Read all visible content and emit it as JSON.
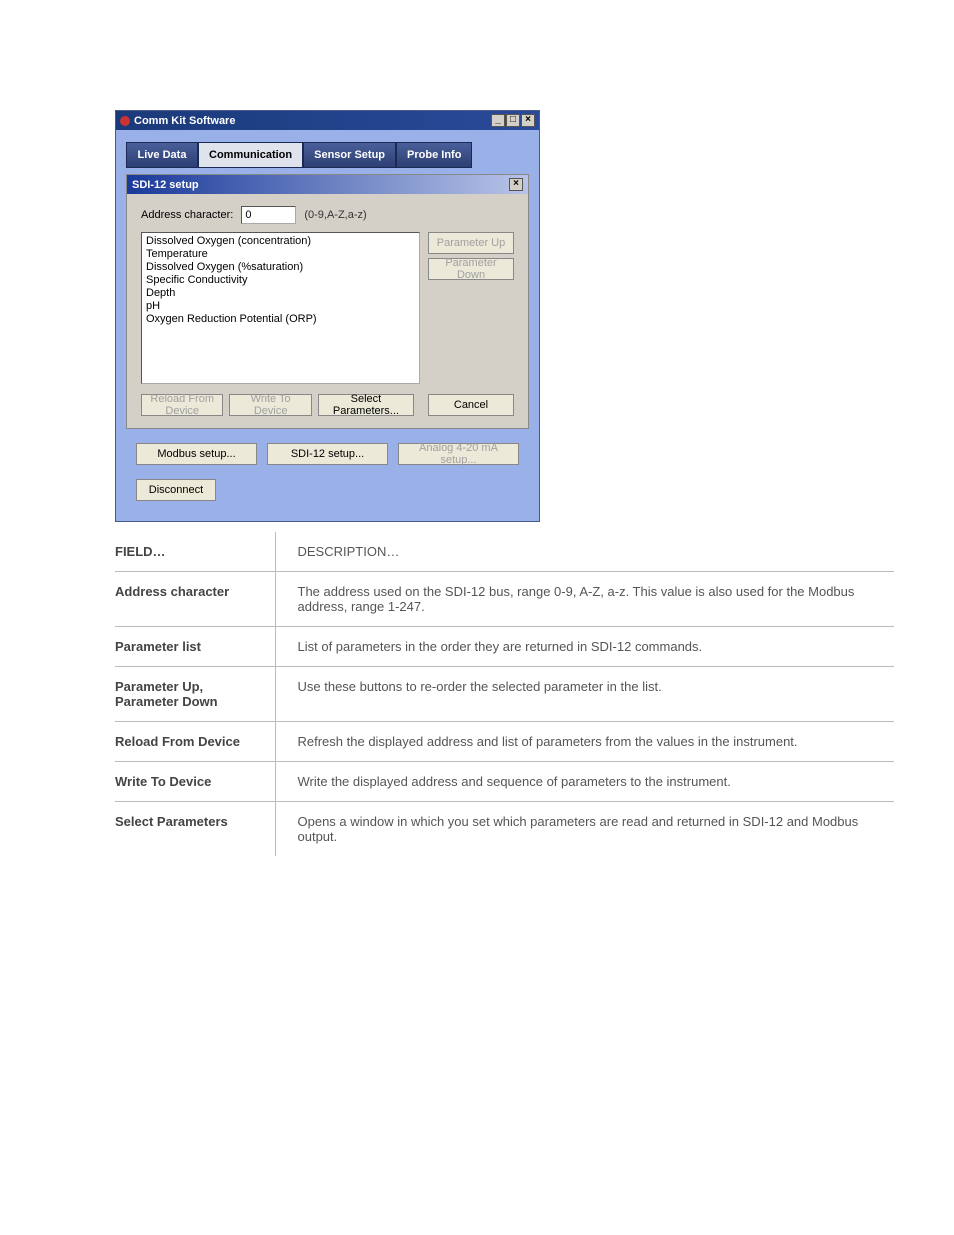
{
  "window": {
    "title": "Comm Kit Software",
    "tabs": [
      "Live Data",
      "Communication",
      "Sensor Setup",
      "Probe Info"
    ],
    "selected_tab": "Communication",
    "panel_title": "SDI-12 setup",
    "address_label": "Address character:",
    "address_value": "0",
    "address_hint": "(0-9,A-Z,a-z)",
    "params": [
      "Dissolved Oxygen (concentration)",
      "Temperature",
      "Dissolved Oxygen (%saturation)",
      "Specific Conductivity",
      "Depth",
      "pH",
      "Oxygen Reduction Potential (ORP)"
    ],
    "btn_param_up": "Parameter Up",
    "btn_param_down": "Parameter Down",
    "btn_reload": "Reload From Device",
    "btn_write": "Write To Device",
    "btn_select": "Select Parameters...",
    "btn_cancel": "Cancel",
    "btn_modbus": "Modbus setup...",
    "btn_sdi12": "SDI-12 setup...",
    "btn_analog": "Analog 4-20 mA setup...",
    "btn_disconnect": "Disconnect"
  },
  "table": {
    "rows": [
      {
        "term": "FIELD…",
        "def": "DESCRIPTION…"
      },
      {
        "term": "Address character",
        "def": "The address used on the SDI-12 bus, range 0-9, A-Z, a-z. This value is also used for the Modbus address, range 1-247."
      },
      {
        "term": "Parameter list",
        "def": "List of parameters in the order they are returned in SDI-12 commands."
      },
      {
        "term": "Parameter Up, Parameter Down",
        "def": "Use these buttons to re-order the selected parameter in the list."
      },
      {
        "term": "Reload From Device",
        "def": "Refresh the displayed address and list of parameters from the values in the instrument."
      },
      {
        "term": "Write To Device",
        "def": "Write the displayed address and sequence of parameters to the instrument."
      },
      {
        "term": "Select Parameters",
        "def": "Opens a window in which you set which parameters are read and returned in SDI-12 and Modbus output."
      }
    ]
  }
}
